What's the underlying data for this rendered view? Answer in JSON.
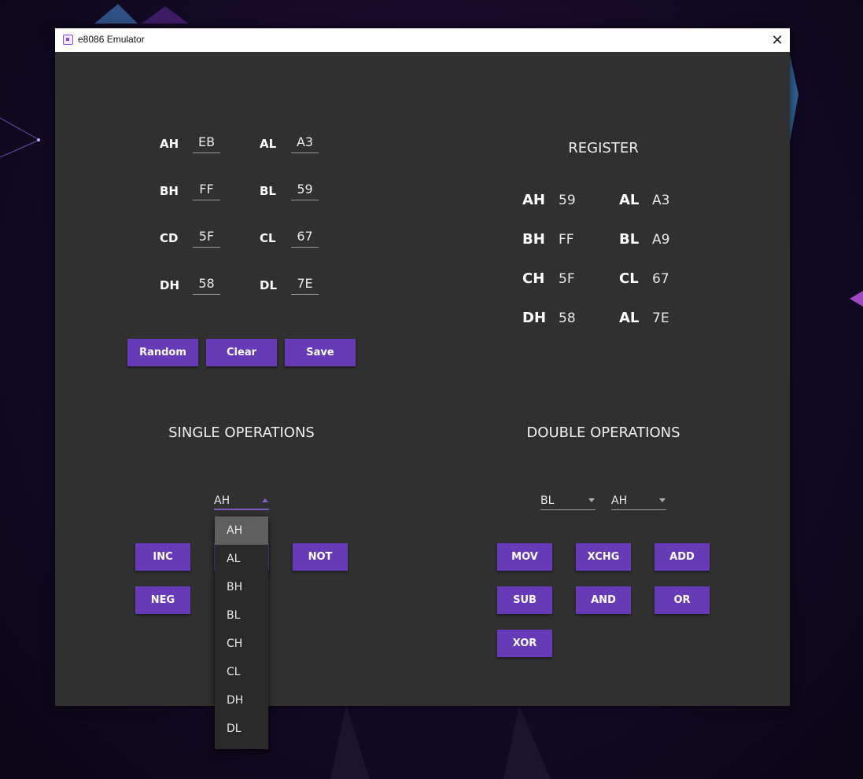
{
  "window": {
    "title": "e8086 Emulator",
    "close_glyph": "✕"
  },
  "inputs": {
    "rows": [
      {
        "left_label": "AH",
        "left_value": "EB",
        "right_label": "AL",
        "right_value": "A3"
      },
      {
        "left_label": "BH",
        "left_value": "FF",
        "right_label": "BL",
        "right_value": "59"
      },
      {
        "left_label": "CD",
        "left_value": "5F",
        "right_label": "CL",
        "right_value": "67"
      },
      {
        "left_label": "DH",
        "left_value": "58",
        "right_label": "DL",
        "right_value": "7E"
      }
    ],
    "buttons": {
      "random": "Random",
      "clear": "Clear",
      "save": "Save"
    }
  },
  "register": {
    "heading": "REGISTER",
    "rows": [
      {
        "left_label": "AH",
        "left_value": "59",
        "right_label": "AL",
        "right_value": "A3"
      },
      {
        "left_label": "BH",
        "left_value": "FF",
        "right_label": "BL",
        "right_value": "A9"
      },
      {
        "left_label": "CH",
        "left_value": "5F",
        "right_label": "CL",
        "right_value": "67"
      },
      {
        "left_label": "DH",
        "left_value": "58",
        "right_label": "AL",
        "right_value": "7E"
      }
    ]
  },
  "single_ops": {
    "heading": "SINGLE OPERATIONS",
    "selected": "AH",
    "options": [
      "AH",
      "AL",
      "BH",
      "BL",
      "CH",
      "CL",
      "DH",
      "DL"
    ],
    "buttons": {
      "inc": "INC",
      "not": "NOT",
      "neg": "NEG"
    }
  },
  "double_ops": {
    "heading": "DOUBLE OPERATIONS",
    "source": "BL",
    "dest": "AH",
    "buttons": {
      "mov": "MOV",
      "xchg": "XCHG",
      "add": "ADD",
      "sub": "SUB",
      "and": "AND",
      "or": "OR",
      "xor": "XOR"
    }
  },
  "colors": {
    "accent": "#673ab7",
    "window_bg": "#303030",
    "titlebar_bg": "#ffffff"
  }
}
